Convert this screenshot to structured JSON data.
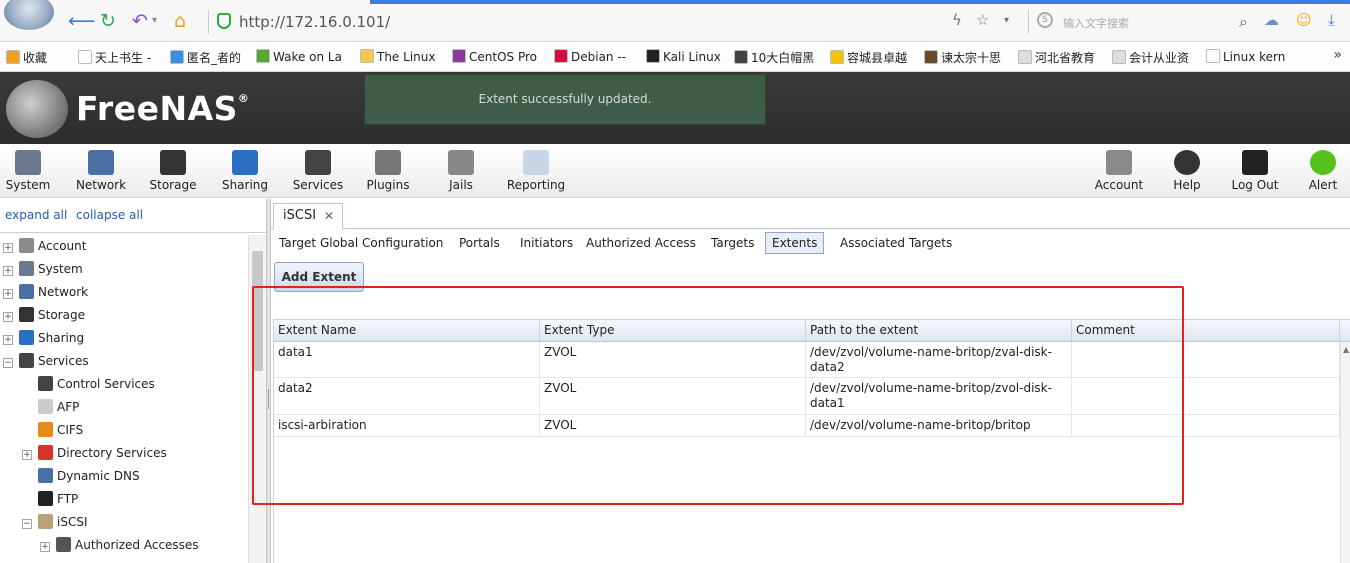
{
  "browser": {
    "url": "http://172.16.0.101/",
    "search_placeholder": "输入文字搜索",
    "bookmarks": [
      {
        "label": "收藏",
        "color": "#f0a020"
      },
      {
        "label": "天上书生 -",
        "color": "#ffffff"
      },
      {
        "label": "匿名_者的",
        "color": "#3b8fe0"
      },
      {
        "label": "Wake on La",
        "color": "#55a832"
      },
      {
        "label": "The Linux",
        "color": "#f2c94c"
      },
      {
        "label": "CentOS Pro",
        "color": "#8a3a9b"
      },
      {
        "label": "Debian --",
        "color": "#d0103a"
      },
      {
        "label": "Kali Linux",
        "color": "#222222"
      },
      {
        "label": "10大白帽黑",
        "color": "#444444"
      },
      {
        "label": "容城县卓越",
        "color": "#f5c400"
      },
      {
        "label": "谏太宗十思",
        "color": "#6b4a2a"
      },
      {
        "label": "河北省教育",
        "color": "#dddddd"
      },
      {
        "label": "会计从业资",
        "color": "#dddddd"
      },
      {
        "label": "Linux kern",
        "color": "#ffffff"
      }
    ]
  },
  "header": {
    "logo": "FreeNAS",
    "logo_mark": "®",
    "notice": "Extent successfully updated."
  },
  "toolbar": {
    "left": [
      {
        "label": "System",
        "icon": "system-icon",
        "color": "#6a7a8c"
      },
      {
        "label": "Network",
        "icon": "network-icon",
        "color": "#4a6fa5"
      },
      {
        "label": "Storage",
        "icon": "storage-icon",
        "color": "#333333"
      },
      {
        "label": "Sharing",
        "icon": "sharing-icon",
        "color": "#2b6fc2"
      },
      {
        "label": "Services",
        "icon": "services-icon",
        "color": "#444444"
      },
      {
        "label": "Plugins",
        "icon": "plugins-icon",
        "color": "#777777"
      },
      {
        "label": "Jails",
        "icon": "jails-icon",
        "color": "#888888"
      },
      {
        "label": "Reporting",
        "icon": "reporting-icon",
        "color": "#c9d6e8"
      }
    ],
    "right": [
      {
        "label": "Account",
        "icon": "account-icon",
        "color": "#8a8a8a"
      },
      {
        "label": "Help",
        "icon": "help-icon",
        "color": "#333333"
      },
      {
        "label": "Log Out",
        "icon": "logout-icon",
        "color": "#222222"
      },
      {
        "label": "Alert",
        "icon": "alert-icon",
        "color": "#57c21e"
      }
    ]
  },
  "tree": {
    "expand_all": "expand all",
    "collapse_all": "collapse all",
    "items": [
      {
        "label": "Account",
        "level": 0,
        "expander": "+",
        "icon_color": "#8a8a8a"
      },
      {
        "label": "System",
        "level": 0,
        "expander": "+",
        "icon_color": "#6a7a8c"
      },
      {
        "label": "Network",
        "level": 0,
        "expander": "+",
        "icon_color": "#4a6fa5"
      },
      {
        "label": "Storage",
        "level": 0,
        "expander": "+",
        "icon_color": "#333333"
      },
      {
        "label": "Sharing",
        "level": 0,
        "expander": "+",
        "icon_color": "#2b6fc2"
      },
      {
        "label": "Services",
        "level": 0,
        "expander": "−",
        "icon_color": "#444444"
      },
      {
        "label": "Control Services",
        "level": 1,
        "expander": "",
        "icon_color": "#444444"
      },
      {
        "label": "AFP",
        "level": 1,
        "expander": "",
        "icon_color": "#cccccc"
      },
      {
        "label": "CIFS",
        "level": 1,
        "expander": "",
        "icon_color": "#e88a1a"
      },
      {
        "label": "Directory Services",
        "level": 1,
        "expander": "+",
        "icon_color": "#d9342b"
      },
      {
        "label": "Dynamic DNS",
        "level": 1,
        "expander": "",
        "icon_color": "#4a6fa5"
      },
      {
        "label": "FTP",
        "level": 1,
        "expander": "",
        "icon_color": "#222222"
      },
      {
        "label": "iSCSI",
        "level": 1,
        "expander": "−",
        "icon_color": "#b9a27a"
      },
      {
        "label": "Authorized Accesses",
        "level": 2,
        "expander": "+",
        "icon_color": "#555555"
      }
    ]
  },
  "content": {
    "main_tab": "iSCSI",
    "subtabs": [
      "Target Global Configuration",
      "Portals",
      "Initiators",
      "Authorized Access",
      "Targets",
      "Extents",
      "Associated Targets"
    ],
    "active_subtab": "Extents",
    "add_button": "Add Extent",
    "table": {
      "columns": [
        "Extent Name",
        "Extent Type",
        "Path to the extent",
        "Comment"
      ],
      "rows": [
        {
          "name": "data1",
          "type": "ZVOL",
          "path": "/dev/zvol/volume-name-britop/zval-disk-data2",
          "comment": ""
        },
        {
          "name": "data2",
          "type": "ZVOL",
          "path": "/dev/zvol/volume-name-britop/zvol-disk-data1",
          "comment": ""
        },
        {
          "name": "iscsi-arbiration",
          "type": "ZVOL",
          "path": "/dev/zvol/volume-name-britop/britop",
          "comment": ""
        }
      ]
    }
  }
}
